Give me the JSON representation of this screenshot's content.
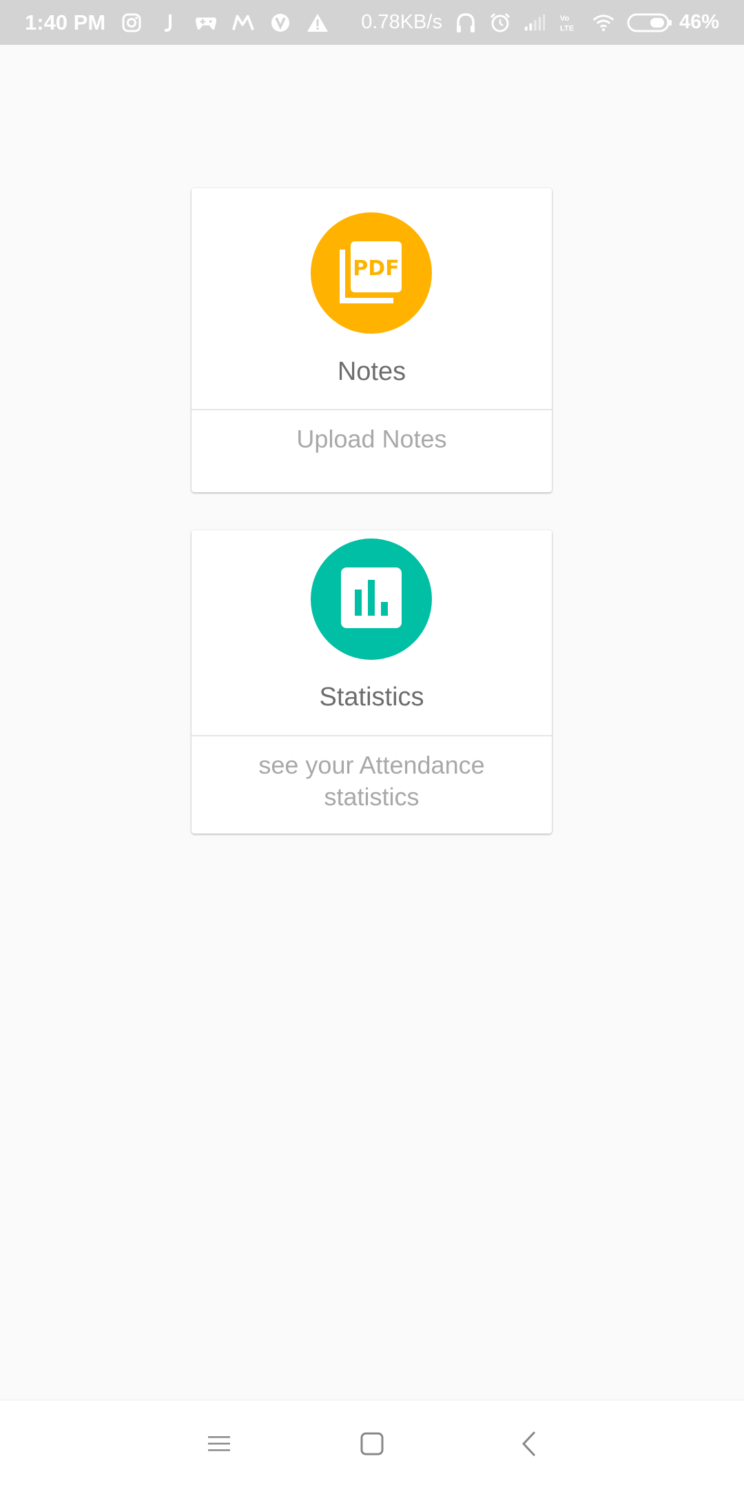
{
  "status_bar": {
    "time": "1:40 PM",
    "net_speed": "0.78KB/s",
    "battery_percent": "46%",
    "icons": [
      "instagram-icon",
      "j-app-icon",
      "game-controller-icon",
      "m-app-icon",
      "vpn-icon",
      "warning-icon",
      "headphones-icon",
      "alarm-icon",
      "signal-icon",
      "volte-icon",
      "wifi-icon",
      "battery-icon"
    ]
  },
  "cards": [
    {
      "icon": "pdf-icon",
      "icon_bg": "#ffb300",
      "title": "Notes",
      "subtitle": "Upload Notes"
    },
    {
      "icon": "bar-chart-icon",
      "icon_bg": "#00bfa5",
      "title": "Statistics",
      "subtitle": "see your Attendance statistics"
    }
  ],
  "icon_text": {
    "pdf": "PDF"
  },
  "nav_bar": {
    "buttons": [
      "menu",
      "home",
      "back"
    ]
  }
}
